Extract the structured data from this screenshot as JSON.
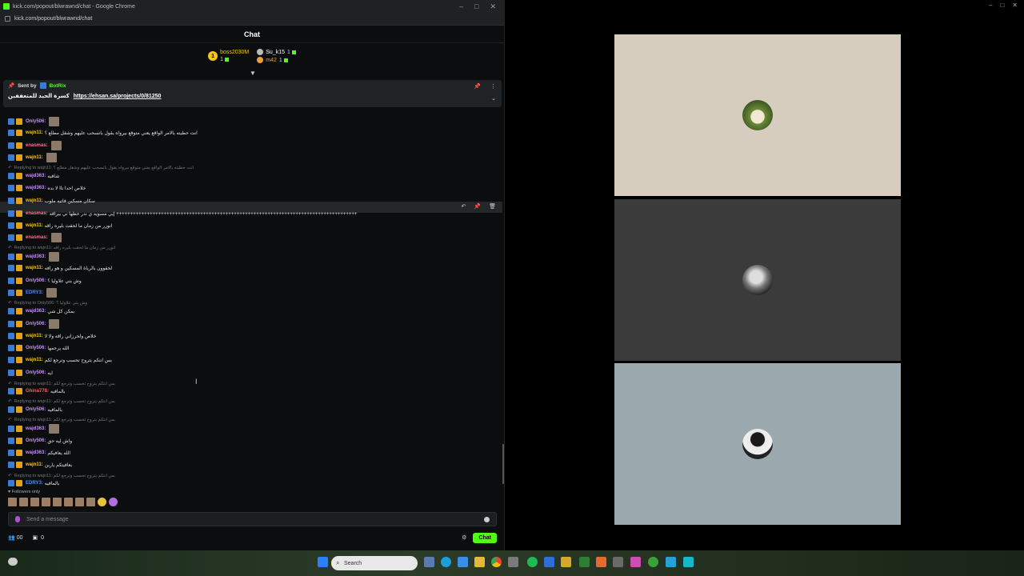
{
  "browser": {
    "title": "kick.com/popout/blwrawnd/chat - Google Chrome",
    "url": "kick.com/popout/blwrawnd/chat"
  },
  "chat": {
    "header": "Chat",
    "top_gifters": [
      {
        "rank": "1",
        "name": "boss2030M",
        "count": "1"
      },
      {
        "name": "Su_k15",
        "count": "1"
      },
      {
        "name": "m42",
        "count": "1"
      }
    ],
    "pinned": {
      "sent_by_label": "Sent by",
      "sender": "BotRix",
      "text": "كسرة الحيد للمتعففين",
      "link": "https://ehsan.sa/projects/0/81250"
    },
    "messages": [
      {
        "user": "Only506:",
        "text": "",
        "color": "#c98cff"
      },
      {
        "user": "wajn11:",
        "text": "انت حطيته بالامر الواقع يعني متوقع بيرواه يقول بانسحب عليهم وشقل مطلع ؟",
        "color": "#f5c518"
      },
      {
        "user": "enasmas:",
        "text": "",
        "color": "#ff6f91"
      },
      {
        "user": "wajn11:",
        "text": "",
        "color": "#f5c518"
      },
      {
        "reply": "Replying to wajn11: انت حطيته بالامر الواقع يعني متوقع بيرواه يقول بانسحب عليهم وشقل مطلع ؟"
      },
      {
        "user": "wajd363:",
        "text": "شافيه",
        "color": "#c98cff"
      },
      {
        "user": "wajd363:",
        "text": "خلاص احدا ناا لا بده",
        "color": "#c98cff"
      },
      {
        "user": "wajn11:",
        "text": "سكان مسكين فاتيه ملوب",
        "color": "#f5c518"
      },
      {
        "user": "enasmas:",
        "text": "إيي مسويه ي ندر حظها ني بيراقه ++++++++++++++++++++++++++++++++++++++++++++++++++++++++++++++++++++++++++++++++++++++",
        "color": "#ff6f91"
      },
      {
        "user": "wajn11:",
        "text": "انورر من زمان ما لحقت بليره راقه",
        "color": "#f5c518"
      },
      {
        "user": "enasmas:",
        "text": "",
        "color": "#ff6f91"
      },
      {
        "reply": "Replying to wajn11: انورر من زمان ما لحقت بليره راقه"
      },
      {
        "user": "wajd363:",
        "text": "",
        "color": "#c98cff"
      },
      {
        "user": "wajn11:",
        "text": "لحقوون بالرياة المسكين و هو رافه",
        "color": "#f5c518"
      },
      {
        "user": "Only506:",
        "text": "وش بتي علاوليا ؟",
        "color": "#c98cff"
      },
      {
        "user": "EDRY3:",
        "text": "",
        "color": "#4d8cff"
      },
      {
        "reply": "Replying to Only506: وش بتي علاوليا ؟"
      },
      {
        "user": "wajd363:",
        "text": "بمكن كل شي",
        "color": "#c98cff"
      },
      {
        "user": "Only506:",
        "text": "",
        "color": "#c98cff"
      },
      {
        "user": "wajn11:",
        "text": "خلاص ولحرزاني راقه ولا لا",
        "color": "#f5c518"
      },
      {
        "user": "Only506:",
        "text": "الله يرحمها",
        "color": "#c98cff"
      },
      {
        "user": "wajn11:",
        "text": "بس انتكم يتروح تحسب وترجع لكم",
        "color": "#f5c518"
      },
      {
        "user": "Only506:",
        "text": "ايه",
        "color": "#c98cff"
      },
      {
        "reply": "Replying to wajn11: بس انتكم يتروح تحسب وترجع لكم"
      },
      {
        "user": "Ghina778:",
        "text": "بالمافيه",
        "color": "#ff5a5a"
      },
      {
        "reply": "Replying to wajn11: بس انتكم يتروح تحسب وترجع لكم"
      },
      {
        "user": "Only506:",
        "text": "بالمافيه",
        "color": "#c98cff"
      },
      {
        "reply": "Replying to wajn11: بس انتكم يتروح تحسب وترجع لكم"
      },
      {
        "user": "wajd363:",
        "text": "",
        "color": "#c98cff"
      },
      {
        "user": "Only506:",
        "text": "واش ليه حق",
        "color": "#c98cff"
      },
      {
        "user": "wajd363:",
        "text": "الله يعافيكم",
        "color": "#c98cff"
      },
      {
        "user": "wajn11:",
        "text": "بعافيتكم ياربن",
        "color": "#f5c518"
      },
      {
        "reply": "Replying to wajn11: بس انتكم يتروح تحسب وترجع لكم"
      },
      {
        "user": "EDRY3:",
        "text": "بالمافيه",
        "color": "#4d8cff"
      }
    ],
    "followers_only": "Followers only",
    "input_placeholder": "Send a message",
    "viewer_count": "00",
    "points": "0",
    "chat_button": "Chat"
  },
  "taskbar": {
    "search_placeholder": "Search"
  },
  "tiles": [
    {
      "bg": "#d6cdbf"
    },
    {
      "bg": "#3b3b3b"
    },
    {
      "bg": "#9ba8ae"
    }
  ]
}
